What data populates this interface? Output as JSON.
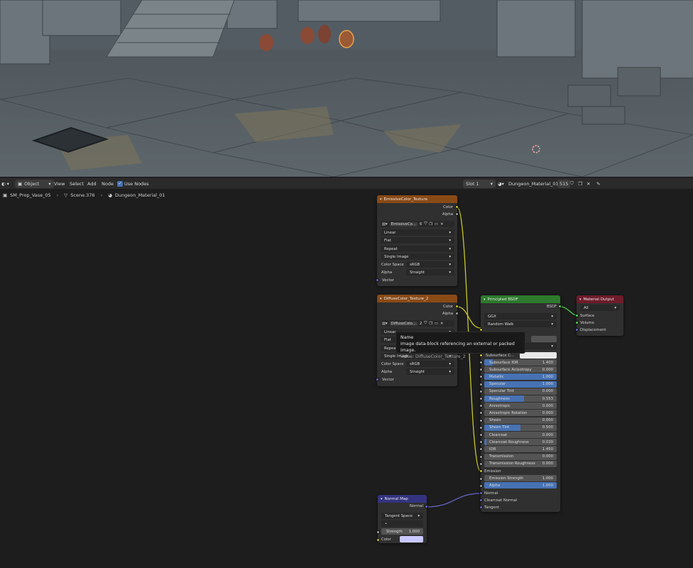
{
  "viewport": {
    "description_icon": "viewport-3d"
  },
  "header": {
    "editor_type_icon": "node-editor-icon",
    "mode": "Object",
    "menus": [
      "View",
      "Select",
      "Add",
      "Node"
    ],
    "use_nodes_label": "Use Nodes",
    "slot": "Slot 1",
    "material_name": "Dungeon_Material_01",
    "user_count": "515"
  },
  "breadcrumb": {
    "object": "SM_Prop_Vase_05",
    "mesh": "Scene.376",
    "material": "Dungeon_Material_01"
  },
  "colors": {
    "texture_header": "#8a4a16",
    "shader_header": "#2d7a2d",
    "output_header": "#6e1c2a",
    "vector_header": "#333380",
    "accent_blue": "#4772b3"
  },
  "emissive_node": {
    "title": "EmissiveColor_Texture",
    "out_color": "Color",
    "out_alpha": "Alpha",
    "image_name": "EmissiveCo...",
    "image_users": "6",
    "interpolation": "Linear",
    "projection": "Flat",
    "extension": "Repeat",
    "source": "Single Image",
    "color_space_label": "Color Space",
    "color_space": "sRGB",
    "alpha_label": "Alpha",
    "alpha_mode": "Straight",
    "in_vector": "Vector"
  },
  "diffuse_node": {
    "title": "DiffuseColor_Texture_2",
    "out_color": "Color",
    "out_alpha": "Alpha",
    "image_name": "DiffuseColo...",
    "image_users": "2",
    "interpolation": "Linear",
    "projection": "Flat",
    "extension": "Repeat",
    "source": "Single Image",
    "color_space_label": "Color Space",
    "color_space": "sRGB",
    "alpha_label": "Alpha",
    "alpha_mode": "Straight",
    "in_vector": "Vector"
  },
  "bsdf_node": {
    "title": "Principled BSDF",
    "out_bsdf": "BSDF",
    "distribution": "GGX",
    "subsurface_method": "Random Walk",
    "subsurface_color_label": "Subsurface C...",
    "params": [
      {
        "label": "Subsurface IOR",
        "value": "1.400",
        "fill": 0.12
      },
      {
        "label": "Subsurface Anisotropy",
        "value": "0.000",
        "fill": 0
      },
      {
        "label": "Metallic",
        "value": "1.000",
        "fill": 1
      },
      {
        "label": "Specular",
        "value": "1.000",
        "fill": 1
      },
      {
        "label": "Specular Tint",
        "value": "0.000",
        "fill": 0
      },
      {
        "label": "Roughness",
        "value": "0.553",
        "fill": 0.553
      },
      {
        "label": "Anisotropic",
        "value": "0.000",
        "fill": 0
      },
      {
        "label": "Anisotropic Rotation",
        "value": "0.000",
        "fill": 0
      },
      {
        "label": "Sheen",
        "value": "0.000",
        "fill": 0
      },
      {
        "label": "Sheen Tint",
        "value": "0.500",
        "fill": 0.5
      },
      {
        "label": "Clearcoat",
        "value": "0.000",
        "fill": 0
      },
      {
        "label": "Clearcoat Roughness",
        "value": "0.030",
        "fill": 0.03
      },
      {
        "label": "IOR",
        "value": "1.450",
        "fill": 0
      },
      {
        "label": "Transmission",
        "value": "0.000",
        "fill": 0
      },
      {
        "label": "Transmission Roughness",
        "value": "0.000",
        "fill": 0
      }
    ],
    "emission_label": "Emission",
    "emission_strength_label": "Emission Strength",
    "emission_strength": "1.000",
    "alpha_label": "Alpha",
    "alpha_value": "1.000",
    "alpha_fill": 1,
    "normal_label": "Normal",
    "clearcoat_normal_label": "Clearcoat Normal",
    "tangent_label": "Tangent"
  },
  "output_node": {
    "title": "Material Output",
    "target": "All",
    "surface": "Surface",
    "volume": "Volume",
    "displacement": "Displacement"
  },
  "normalmap_node": {
    "title": "Normal Map",
    "out_normal": "Normal",
    "space": "Tangent Space",
    "strength_label": "Strength",
    "strength": "1.000",
    "color_label": "Color",
    "color_swatch": "#c9c9ff"
  },
  "tooltip": {
    "title": "Name",
    "description": "Image data-block referencing an external or packed image.",
    "value": "Value: DiffuseColor_Texture_2"
  }
}
